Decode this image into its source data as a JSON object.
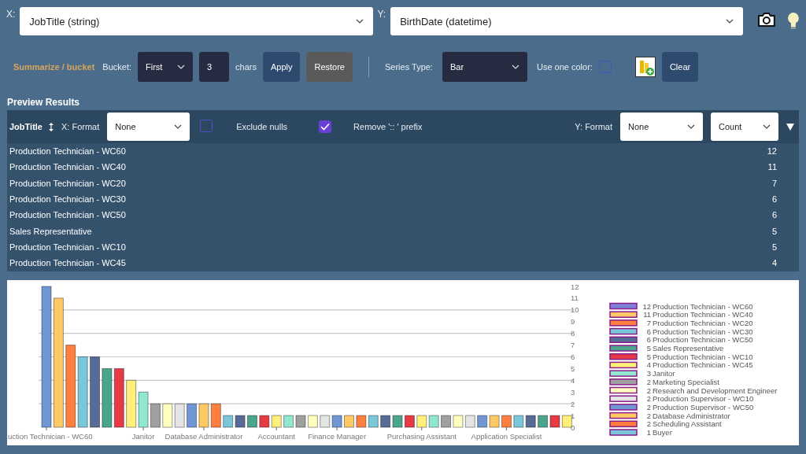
{
  "x_axis": {
    "label": "X:",
    "value": "JobTitle  (string)"
  },
  "y_axis": {
    "label": "Y:",
    "value": "BirthDate  (datetime)"
  },
  "toolbar": {
    "section_title": "Summarize / bucket",
    "bucket_label": "Bucket:",
    "bucket_mode": "First",
    "bucket_size": "3",
    "bucket_unit": "chars",
    "apply": "Apply",
    "restore": "Restore",
    "series_type_label": "Series Type:",
    "series_type": "Bar",
    "one_color": {
      "label": "Use one color:",
      "checked": false
    },
    "clear": "Clear"
  },
  "preview": {
    "title": "Preview Results",
    "column": "JobTitle",
    "x_format_label": "X: Format",
    "x_format": "None",
    "exclude_nulls": {
      "label": "Exclude nulls",
      "checked": false
    },
    "remove_prefix": {
      "label": "Remove ':: ' prefix",
      "checked": true
    },
    "y_format_label": "Y: Format",
    "y_format": "None",
    "aggregate": "Count",
    "rows": [
      {
        "name": "Production Technician - WC60",
        "value": "12"
      },
      {
        "name": "Production Technician - WC40",
        "value": "11"
      },
      {
        "name": "Production Technician - WC20",
        "value": "7"
      },
      {
        "name": "Production Technician - WC30",
        "value": "6"
      },
      {
        "name": "Production Technician - WC50",
        "value": "6"
      },
      {
        "name": "Sales Representative",
        "value": "5"
      },
      {
        "name": "Production Technician - WC10",
        "value": "5"
      },
      {
        "name": "Production Technician - WC45",
        "value": "4"
      }
    ]
  },
  "chart": {
    "chart_data": {
      "type": "bar",
      "values": [
        12,
        11,
        7,
        6,
        6,
        5,
        5,
        4,
        3,
        2,
        2,
        2,
        2,
        2,
        2,
        1,
        1,
        1,
        1,
        1,
        1,
        1,
        1,
        1,
        1,
        1,
        1,
        1,
        1,
        1,
        1,
        1,
        1,
        1,
        1,
        1,
        1,
        1,
        1,
        1,
        1,
        1,
        1,
        1
      ],
      "categories": [
        "uction Technician - WC60",
        null,
        null,
        null,
        null,
        null,
        null,
        null,
        "Janitor",
        null,
        null,
        null,
        null,
        "Database Administrator",
        null,
        null,
        null,
        null,
        null,
        "Accountant",
        null,
        null,
        null,
        null,
        "Finance Manager",
        null,
        null,
        null,
        null,
        null,
        null,
        "Purchasing Assistant",
        null,
        null,
        null,
        null,
        null,
        null,
        "Application Specialist",
        null,
        null,
        null,
        null,
        null
      ],
      "ylim": [
        0,
        12
      ],
      "yticks": [
        0,
        1,
        2,
        3,
        4,
        5,
        6,
        7,
        8,
        9,
        10,
        11,
        12
      ],
      "grid": true
    },
    "legend": [
      {
        "value": "12",
        "name": "Production Technician - WC60",
        "color": "#7b80d8"
      },
      {
        "value": "11",
        "name": "Production Technician - WC40",
        "color": "#ffc966"
      },
      {
        "value": "7",
        "name": "Production Technician - WC20",
        "color": "#ff7f40"
      },
      {
        "value": "6",
        "name": "Production Technician - WC30",
        "color": "#79c7d9"
      },
      {
        "value": "6",
        "name": "Production Technician - WC50",
        "color": "#566b96"
      },
      {
        "value": "5",
        "name": "Sales Representative",
        "color": "#4aa58c"
      },
      {
        "value": "5",
        "name": "Production Technician - WC10",
        "color": "#e63b44"
      },
      {
        "value": "4",
        "name": "Production Technician - WC45",
        "color": "#fff07a"
      },
      {
        "value": "3",
        "name": "Janitor",
        "color": "#90e8d0"
      },
      {
        "value": "2",
        "name": "Marketing Specialist",
        "color": "#a0a0a0"
      },
      {
        "value": "2",
        "name": "Research and Development Engineer",
        "color": "#ffffc0"
      },
      {
        "value": "2",
        "name": "Production Supervisor - WC10",
        "color": "#e4e4e4"
      },
      {
        "value": "2",
        "name": "Production Supervisor - WC50",
        "color": "#7096d6"
      },
      {
        "value": "2",
        "name": "Database Administrator",
        "color": "#ffc966"
      },
      {
        "value": "2",
        "name": "Scheduling Assistant",
        "color": "#ff7f40"
      },
      {
        "value": "1",
        "name": "Buyer",
        "color": "#79c7d9"
      }
    ]
  }
}
